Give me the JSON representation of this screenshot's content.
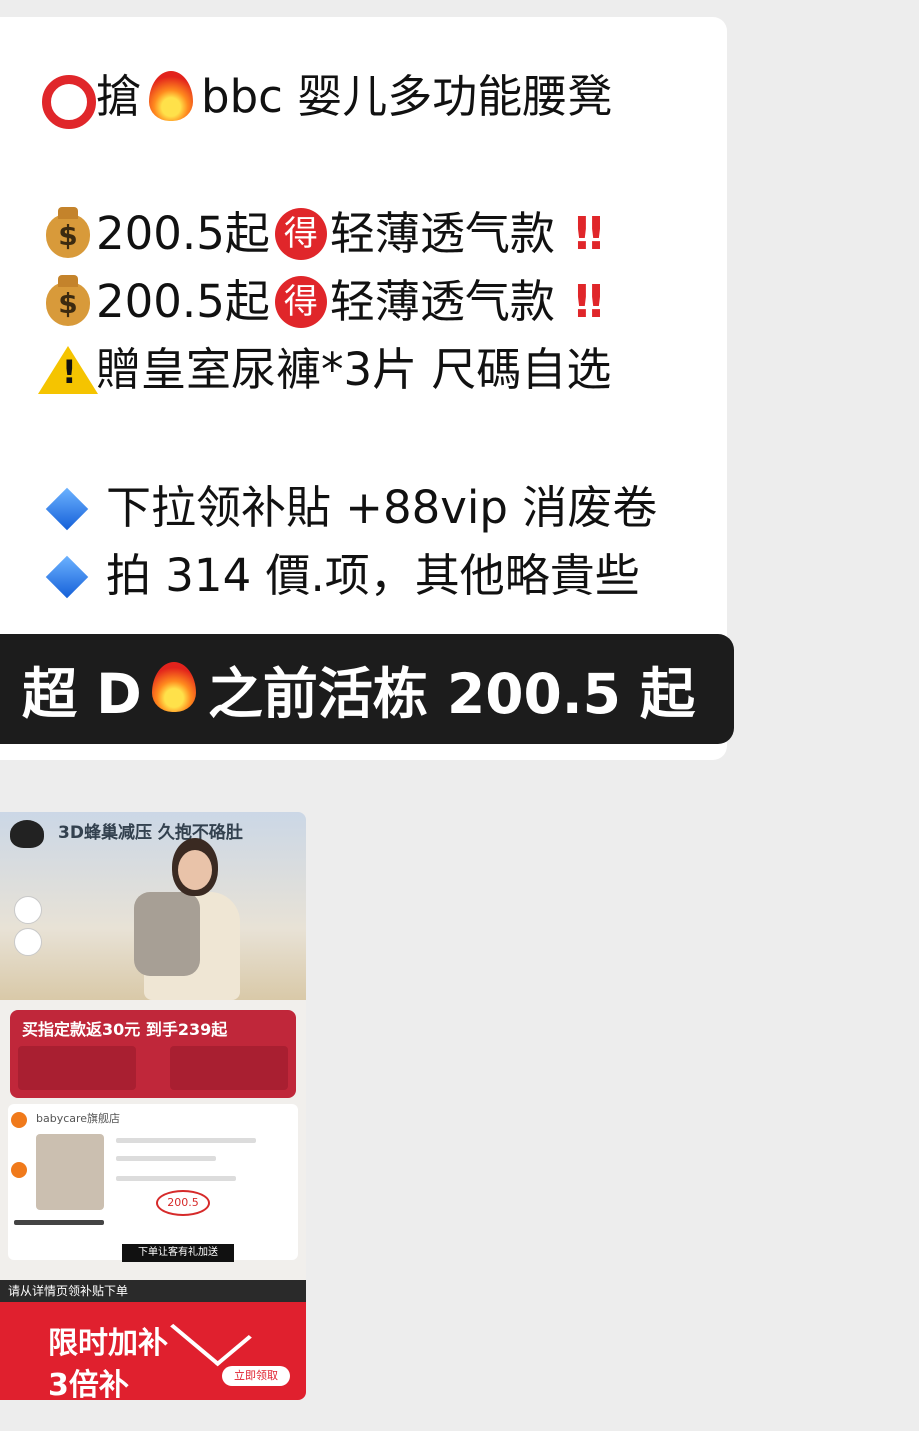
{
  "message": {
    "title": "搶",
    "title_rest": "bbc 婴儿多功能腰凳",
    "price_lines": [
      {
        "price": "200.5起",
        "badge": "得",
        "desc": "轻薄透气款",
        "alert": "‼"
      },
      {
        "price": "200.5起",
        "badge": "得",
        "desc": "轻薄透气款",
        "alert": "‼"
      }
    ],
    "gift_line": "贈皇室尿褲*3片 尺碼自选",
    "tips": [
      "下拉领补貼 +88vip 消废卷",
      "拍 314 價.项，其他略貴些"
    ],
    "banner_a": "超 D",
    "banner_b": "之前活栋 200.5 起"
  },
  "icons": {
    "ring": "red-circle-icon",
    "fire": "fire-icon",
    "money": "money-bag-icon",
    "de": "de-character-icon",
    "warn": "warning-icon",
    "diamond": "blue-diamond-icon",
    "bang": "double-exclamation-icon"
  },
  "thumbnail": {
    "headline": "3D蜂巢减压 久抱不硌肚",
    "promo": "买指定款返30元 到手239起",
    "store": "babycare旗舰店",
    "price_circle": "200.5",
    "label": "下单让客有礼加送",
    "note": "请从详情页领补贴下单",
    "big_1": "限时加补",
    "big_2": "3倍补",
    "pill": "立即领取"
  },
  "colors": {
    "chat_bg": "#ededed",
    "bubble_bg": "#ffffff",
    "banner_bg": "#1c1c1c",
    "accent_red": "#e0262a"
  }
}
